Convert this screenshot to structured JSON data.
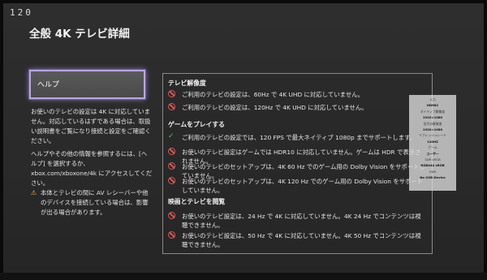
{
  "tv": {
    "channel": "120"
  },
  "page": {
    "title": "全般 4K テレビ詳細"
  },
  "sidebar": {
    "help_button": "ヘルプ",
    "text1": "お使いのテレビの設定は 4K に対応していません。対応しているはずである場合は、取扱い説明書をご覧になり接続と設定をご確認ください。",
    "text2": "ヘルプやその他の情報を参照するには、[ヘルプ] を選択するか、xbox.com/xboxone/4k にアクセスしてください。",
    "warning": "本体とテレビの間に AV レシーバーや他のデバイスを接続している場合は、影響が出る場合があります。"
  },
  "panel": {
    "sections": [
      {
        "heading": "テレビ解像度",
        "rows": [
          {
            "status": "no",
            "text": "ご利用のテレビの設定は、60Hz で 4K UHD に対応していません。"
          },
          {
            "status": "no",
            "text": "ご利用のテレビの設定は、120Hz で 4K UHD に対応していません。"
          }
        ]
      },
      {
        "heading": "ゲームをプレイする",
        "rows": [
          {
            "status": "ok",
            "text": "ご利用のテレビの設定では、120 FPS で最大ネイティブ 1080p までサポートします。"
          },
          {
            "status": "no",
            "text": "お使いのテレビ設定はゲームでは HDR10 に対応していません。ゲームは HDR で表示されません。"
          },
          {
            "status": "no",
            "text": "お使いのテレビのセットアップは、4K 60 Hz でのゲーム用の Dolby Vision をサポートしていません。"
          },
          {
            "status": "no",
            "text": "お使いのテレビのセットアップは、4K 120 Hz でのゲーム用の Dolby Vision をサポートしていません。"
          }
        ]
      },
      {
        "heading": "映画とテレビを閲覧",
        "rows": [
          {
            "status": "no",
            "text": "お使いのテレビ設定は、24 Hz で 4K に対応していません。4K 24 Hz でコンテンツは視聴できません。"
          },
          {
            "status": "no",
            "text": "お使いのテレビ設定は、50 Hz で 4K に対応していません。4K 50 Hz でコンテンツは視聴できません。"
          }
        ]
      }
    ]
  },
  "overlay": {
    "rows": [
      {
        "k": "入力",
        "v": "HDMI2"
      },
      {
        "k": "ネイティブ解像度",
        "v": "1920×1080"
      },
      {
        "k": "信号の解像度",
        "v": "1920×1080"
      },
      {
        "k": "リフレッシュレート",
        "v": "120HZ"
      },
      {
        "k": "ゲーム",
        "v": "ユーザー"
      },
      {
        "k": "SDR sRGB",
        "v": "RGB444 sRGB"
      },
      {
        "k": "HDR",
        "v": "No USB Device"
      }
    ]
  },
  "colors": {
    "focus": "#b9a6e6",
    "error": "#e05353",
    "ok": "#5fbd6a",
    "warning": "#f2b23a"
  }
}
